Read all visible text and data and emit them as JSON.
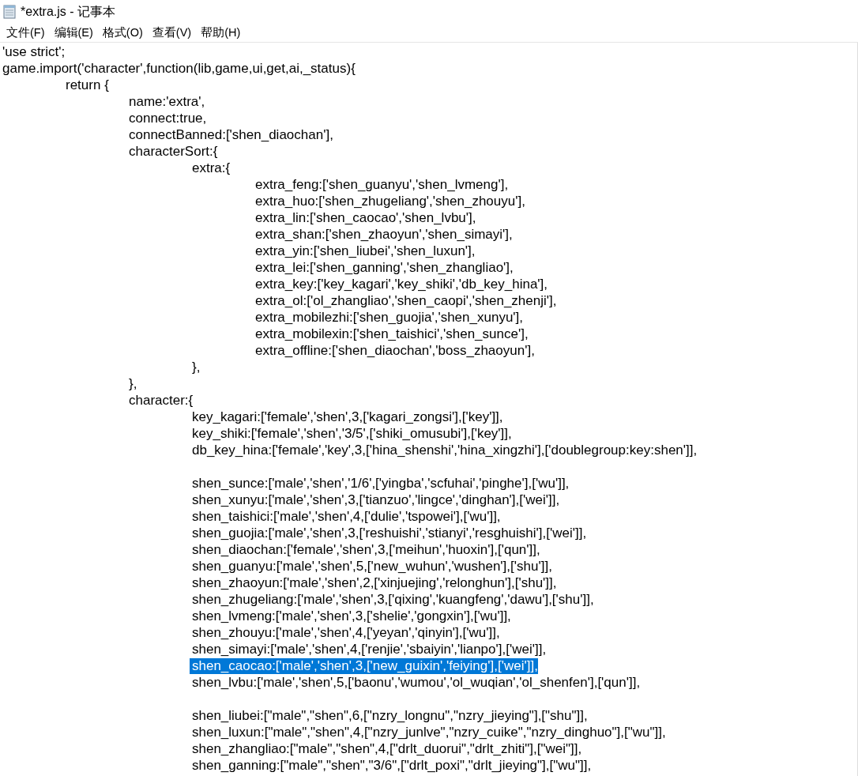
{
  "window": {
    "title": "*extra.js - 记事本"
  },
  "menu": [
    "文件(F)",
    "编辑(E)",
    "格式(O)",
    "查看(V)",
    "帮助(H)"
  ],
  "editor": {
    "blocks": [
      {
        "lines": [
          {
            "text": "'use strict';",
            "selected": false
          },
          {
            "text": "game.import('character',function(lib,game,ui,get,ai,_status){",
            "selected": false
          },
          {
            "text": "\treturn {",
            "selected": false
          },
          {
            "text": "\t\tname:'extra',",
            "selected": false
          },
          {
            "text": "\t\tconnect:true,",
            "selected": false
          },
          {
            "text": "\t\tconnectBanned:['shen_diaochan'],",
            "selected": false
          },
          {
            "text": "\t\tcharacterSort:{",
            "selected": false
          },
          {
            "text": "\t\t\textra:{",
            "selected": false
          },
          {
            "text": "\t\t\t\textra_feng:['shen_guanyu','shen_lvmeng'],",
            "selected": false
          },
          {
            "text": "\t\t\t\textra_huo:['shen_zhugeliang','shen_zhouyu'],",
            "selected": false
          },
          {
            "text": "\t\t\t\textra_lin:['shen_caocao','shen_lvbu'],",
            "selected": false
          },
          {
            "text": "\t\t\t\textra_shan:['shen_zhaoyun','shen_simayi'],",
            "selected": false
          },
          {
            "text": "\t\t\t\textra_yin:['shen_liubei','shen_luxun'],",
            "selected": false
          },
          {
            "text": "\t\t\t\textra_lei:['shen_ganning','shen_zhangliao'],",
            "selected": false
          },
          {
            "text": "\t\t\t\textra_key:['key_kagari','key_shiki','db_key_hina'],",
            "selected": false
          },
          {
            "text": "\t\t\t\textra_ol:['ol_zhangliao','shen_caopi','shen_zhenji'],",
            "selected": false
          },
          {
            "text": "\t\t\t\textra_mobilezhi:['shen_guojia','shen_xunyu'],",
            "selected": false
          },
          {
            "text": "\t\t\t\textra_mobilexin:['shen_taishici','shen_sunce'],",
            "selected": false
          },
          {
            "text": "\t\t\t\textra_offline:['shen_diaochan','boss_zhaoyun'],",
            "selected": false
          },
          {
            "text": "\t\t\t},",
            "selected": false
          },
          {
            "text": "\t\t},",
            "selected": false
          },
          {
            "text": "\t\tcharacter:{",
            "selected": false
          },
          {
            "text": "\t\t\tkey_kagari:['female','shen',3,['kagari_zongsi'],['key']],",
            "selected": false
          },
          {
            "text": "\t\t\tkey_shiki:['female','shen','3/5',['shiki_omusubi'],['key']],",
            "selected": false
          },
          {
            "text": "\t\t\tdb_key_hina:['female','key',3,['hina_shenshi','hina_xingzhi'],['doublegroup:key:shen']],",
            "selected": false
          }
        ]
      },
      {
        "lines": [
          {
            "text": "\t\t\tshen_sunce:['male','shen','1/6',['yingba','scfuhai','pinghe'],['wu']],",
            "selected": false
          },
          {
            "text": "\t\t\tshen_xunyu:['male','shen',3,['tianzuo','lingce','dinghan'],['wei']],",
            "selected": false
          },
          {
            "text": "\t\t\tshen_taishici:['male','shen',4,['dulie','tspowei'],['wu']],",
            "selected": false
          },
          {
            "text": "\t\t\tshen_guojia:['male','shen',3,['reshuishi','stianyi','resghuishi'],['wei']],",
            "selected": false
          },
          {
            "text": "\t\t\tshen_diaochan:['female','shen',3,['meihun','huoxin'],['qun']],",
            "selected": false
          },
          {
            "text": "\t\t\tshen_guanyu:['male','shen',5,['new_wuhun','wushen'],['shu']],",
            "selected": false
          },
          {
            "text": "\t\t\tshen_zhaoyun:['male','shen',2,['xinjuejing','relonghun'],['shu']],",
            "selected": false
          },
          {
            "text": "\t\t\tshen_zhugeliang:['male','shen',3,['qixing','kuangfeng','dawu'],['shu']],",
            "selected": false
          },
          {
            "text": "\t\t\tshen_lvmeng:['male','shen',3,['shelie','gongxin'],['wu']],",
            "selected": false
          },
          {
            "text": "\t\t\tshen_zhouyu:['male','shen',4,['yeyan','qinyin'],['wu']],",
            "selected": false
          },
          {
            "text": "\t\t\tshen_simayi:['male','shen',4,['renjie','sbaiyin','lianpo'],['wei']],",
            "selected": false
          },
          {
            "text": "\t\t\tshen_caocao:['male','shen',3,['new_guixin','feiying'],['wei']],",
            "selected": true
          },
          {
            "text": "\t\t\tshen_lvbu:['male','shen',5,['baonu','wumou','ol_wuqian','ol_shenfen'],['qun']],",
            "selected": false
          }
        ]
      },
      {
        "lines": [
          {
            "text": "\t\t\tshen_liubei:[\"male\",\"shen\",6,[\"nzry_longnu\",\"nzry_jieying\"],[\"shu\"]],",
            "selected": false
          },
          {
            "text": "\t\t\tshen_luxun:[\"male\",\"shen\",4,[\"nzry_junlve\",\"nzry_cuike\",\"nzry_dinghuo\"],[\"wu\"]],",
            "selected": false
          },
          {
            "text": "\t\t\tshen_zhangliao:[\"male\",\"shen\",4,[\"drlt_duorui\",\"drlt_zhiti\"],[\"wei\"]],",
            "selected": false
          },
          {
            "text": "\t\t\tshen_ganning:[\"male\",\"shen\",\"3/6\",[\"drlt_poxi\",\"drlt_jieying\"],[\"wu\"]],",
            "selected": false
          }
        ]
      }
    ]
  }
}
